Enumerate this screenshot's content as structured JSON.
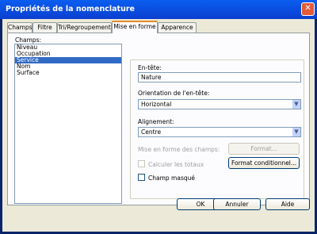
{
  "window": {
    "title": "Propriétés de la nomenclature",
    "close": "✕"
  },
  "tabs": [
    {
      "label": "Champs"
    },
    {
      "label": "Filtre"
    },
    {
      "label": "Tri/Regroupement"
    },
    {
      "label": "Mise en forme"
    },
    {
      "label": "Apparence"
    }
  ],
  "active_tab": "Mise en forme",
  "fields": {
    "label": "Champs:",
    "items": [
      "Niveau",
      "Occupation",
      "Service",
      "Nom",
      "Surface"
    ],
    "selected": "Service"
  },
  "format": {
    "header_label": "En-tête:",
    "header_value": "Nature",
    "orientation_label": "Orientation de l'en-tête:",
    "orientation_value": "Horizontal",
    "alignment_label": "Alignement:",
    "alignment_value": "Centre",
    "field_format_label": "Mise en forme des champs:",
    "format_button": "Format...",
    "calc_totals_label": "Calculer les totaux",
    "conditional_button": "Format conditionnel...",
    "hidden_field_label": "Champ masqué"
  },
  "footer": {
    "ok": "OK",
    "cancel": "Annuler",
    "help": "Aide"
  }
}
